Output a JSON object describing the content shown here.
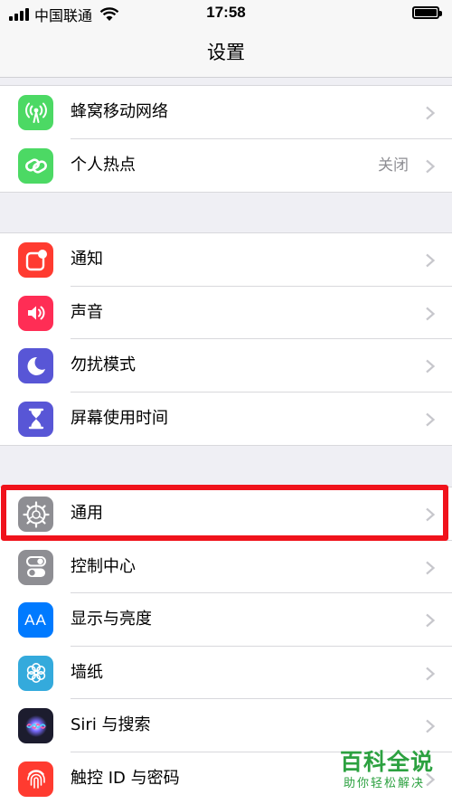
{
  "status_bar": {
    "carrier": "中国联通",
    "time": "17:58"
  },
  "nav": {
    "title": "设置"
  },
  "groups": [
    {
      "rows": [
        {
          "label": "蜂窝移动网络",
          "icon": "antenna-icon",
          "color": "#4cd964"
        },
        {
          "label": "个人热点",
          "value": "关闭",
          "icon": "hotspot-link-icon",
          "color": "#4cd964"
        }
      ]
    },
    {
      "rows": [
        {
          "label": "通知",
          "icon": "notification-icon",
          "color": "#ff3b30"
        },
        {
          "label": "声音",
          "icon": "speaker-icon",
          "color": "#ff2d55"
        },
        {
          "label": "勿扰模式",
          "icon": "moon-icon",
          "color": "#5856d6"
        },
        {
          "label": "屏幕使用时间",
          "icon": "hourglass-icon",
          "color": "#5856d6"
        }
      ]
    },
    {
      "rows": [
        {
          "label": "通用",
          "icon": "gear-icon",
          "color": "#8e8e93"
        },
        {
          "label": "控制中心",
          "icon": "toggle-switches-icon",
          "color": "#8e8e93"
        },
        {
          "label": "显示与亮度",
          "icon": "text-size-icon",
          "icon_text": "AA",
          "color": "#007aff"
        },
        {
          "label": "墙纸",
          "icon": "flower-icon",
          "color": "#34aadc"
        },
        {
          "label": "Siri 与搜索",
          "icon": "siri-icon",
          "color": "#1c1c2e"
        },
        {
          "label": "触控 ID 与密码",
          "icon": "fingerprint-icon",
          "color": "#ff3b30"
        }
      ]
    }
  ],
  "watermark": {
    "title": "百科全说",
    "subtitle": "助你轻松解决"
  },
  "colors": {
    "highlight": "#f0121b",
    "watermark": "#2ca140"
  }
}
